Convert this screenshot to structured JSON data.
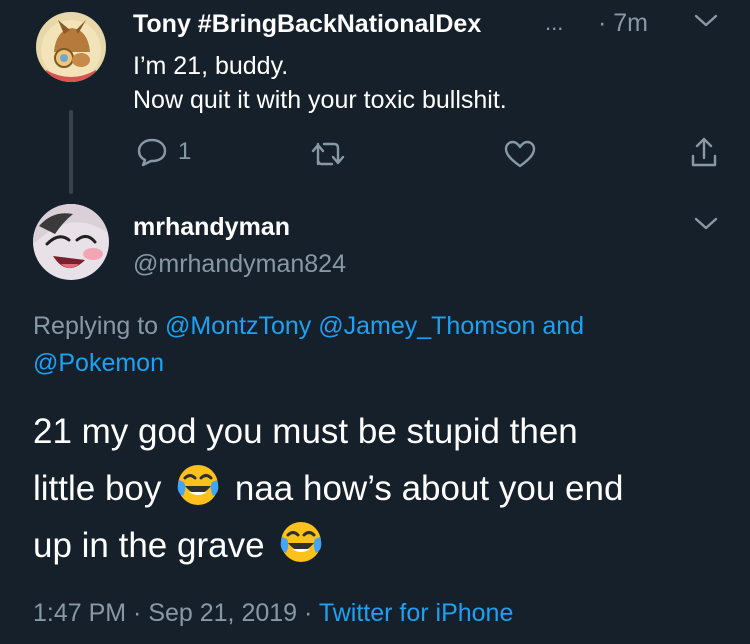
{
  "reply_tweet": {
    "author_name": "Tony #BringBackNationalDex",
    "ellipsis": "...",
    "time": "· 7m",
    "lines": [
      "I’m 21, buddy.",
      "Now quit it with your toxic bullshit."
    ],
    "reply_count": "1"
  },
  "main_tweet": {
    "author_name": "mrhandyman",
    "handle": "@mrhandyman824",
    "replying_to_label": "Replying to",
    "mentions": [
      "@MontzTony",
      "@Jamey_Thomson"
    ],
    "and_label": "and",
    "mention_last": "@Pokemon",
    "text_line1": "21 my god you must be stupid then",
    "text_line2a": "little boy",
    "text_line2b": "naa how’s about you end",
    "text_line3": "up in the grave",
    "time": "1:47 PM · Sep 21, 2019 · ",
    "client": "Twitter for iPhone"
  },
  "colors": {
    "background": "#15202b",
    "muted": "#8899a6",
    "link": "#1da1f2"
  },
  "icons": [
    "reply-icon",
    "retweet-icon",
    "like-icon",
    "share-icon",
    "chevron-down-icon",
    "joy-emoji"
  ]
}
